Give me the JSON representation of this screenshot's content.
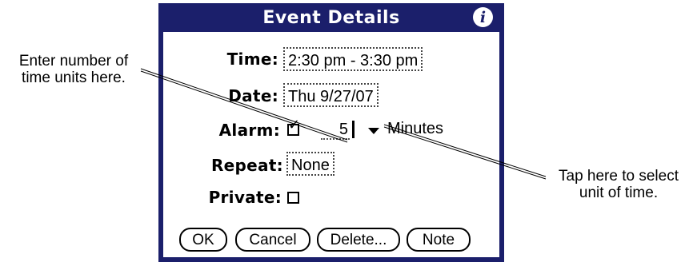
{
  "dialog": {
    "title": "Event Details",
    "info_icon": "i",
    "time": {
      "label": "Time:",
      "value": "2:30 pm - 3:30 pm"
    },
    "date": {
      "label": "Date:",
      "value": "Thu 9/27/07"
    },
    "alarm": {
      "label": "Alarm:",
      "checked": true,
      "check_glyph": "✓",
      "value": "5",
      "unit": "Minutes"
    },
    "repeat": {
      "label": "Repeat:",
      "value": "None"
    },
    "private": {
      "label": "Private:",
      "checked": false
    },
    "buttons": {
      "ok": "OK",
      "cancel": "Cancel",
      "delete": "Delete...",
      "note": "Note"
    }
  },
  "callouts": {
    "left": "Enter number of\ntime units here.",
    "right": "Tap here to select\nunit of time."
  },
  "colors": {
    "titlebar": "#1b1f6b",
    "border": "#1b1f6b",
    "background": "#ffffff"
  }
}
